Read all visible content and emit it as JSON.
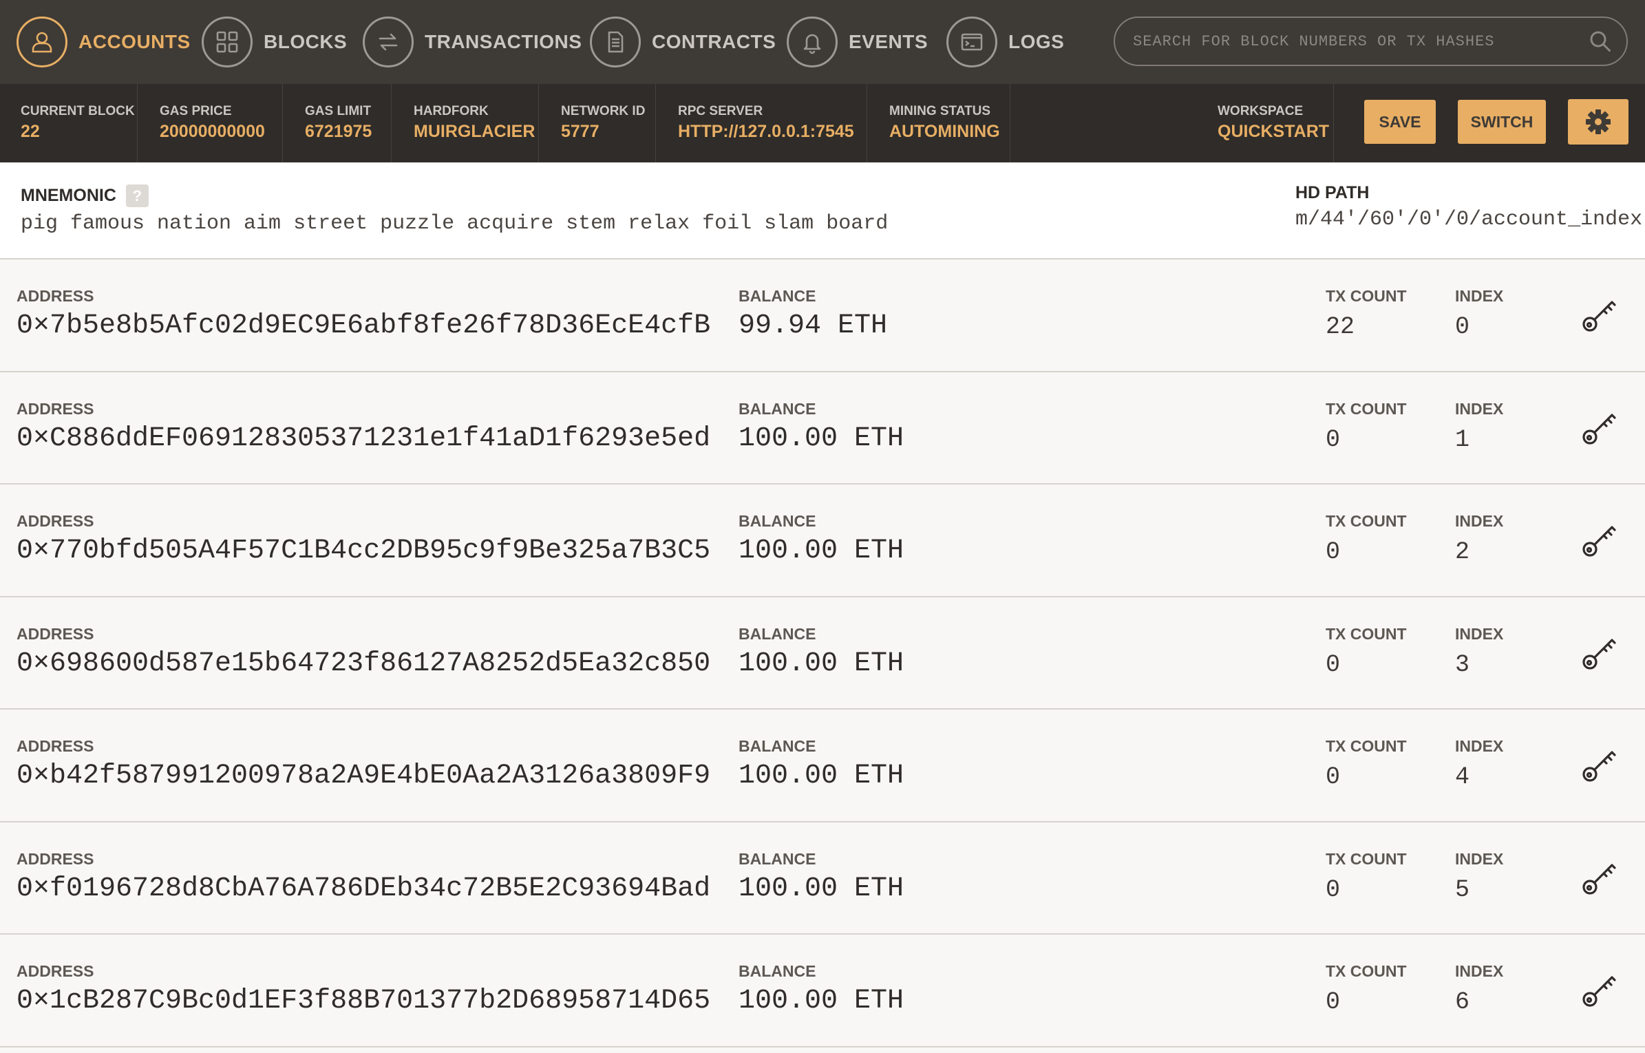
{
  "nav": {
    "items": [
      {
        "label": "ACCOUNTS",
        "icon": "user-icon",
        "active": true
      },
      {
        "label": "BLOCKS",
        "icon": "blocks-icon",
        "active": false
      },
      {
        "label": "TRANSACTIONS",
        "icon": "transactions-icon",
        "active": false
      },
      {
        "label": "CONTRACTS",
        "icon": "contracts-icon",
        "active": false
      },
      {
        "label": "EVENTS",
        "icon": "bell-icon",
        "active": false
      },
      {
        "label": "LOGS",
        "icon": "terminal-icon",
        "active": false
      }
    ],
    "search_placeholder": "SEARCH FOR BLOCK NUMBERS OR TX HASHES"
  },
  "status": {
    "current_block": {
      "label": "CURRENT BLOCK",
      "value": "22"
    },
    "gas_price": {
      "label": "GAS PRICE",
      "value": "20000000000"
    },
    "gas_limit": {
      "label": "GAS LIMIT",
      "value": "6721975"
    },
    "hardfork": {
      "label": "HARDFORK",
      "value": "MUIRGLACIER"
    },
    "network_id": {
      "label": "NETWORK ID",
      "value": "5777"
    },
    "rpc_server": {
      "label": "RPC SERVER",
      "value": "HTTP://127.0.0.1:7545"
    },
    "mining_status": {
      "label": "MINING STATUS",
      "value": "AUTOMINING"
    },
    "workspace": {
      "label": "WORKSPACE",
      "value": "QUICKSTART"
    },
    "save_label": "SAVE",
    "switch_label": "SWITCH"
  },
  "mnemonic": {
    "label": "MNEMONIC",
    "help": "?",
    "words": "pig famous nation aim street puzzle acquire stem relax foil slam board",
    "hd_path_label": "HD PATH",
    "hd_path": "m/44'/60'/0'/0/account_index"
  },
  "labels": {
    "address": "ADDRESS",
    "balance": "BALANCE",
    "tx_count": "TX COUNT",
    "index": "INDEX"
  },
  "accounts": [
    {
      "address": "0×7b5e8b5Afc02d9EC9E6abf8fe26f78D36EcE4cfB",
      "balance": "99.94 ETH",
      "tx_count": "22",
      "index": "0"
    },
    {
      "address": "0×C886ddEF069128305371231e1f41aD1f6293e5ed",
      "balance": "100.00 ETH",
      "tx_count": "0",
      "index": "1"
    },
    {
      "address": "0×770bfd505A4F57C1B4cc2DB95c9f9Be325a7B3C5",
      "balance": "100.00 ETH",
      "tx_count": "0",
      "index": "2"
    },
    {
      "address": "0×698600d587e15b64723f86127A8252d5Ea32c850",
      "balance": "100.00 ETH",
      "tx_count": "0",
      "index": "3"
    },
    {
      "address": "0×b42f587991200978a2A9E4bE0Aa2A3126a3809F9",
      "balance": "100.00 ETH",
      "tx_count": "0",
      "index": "4"
    },
    {
      "address": "0×f0196728d8CbA76A786DEb34c72B5E2C93694Bad",
      "balance": "100.00 ETH",
      "tx_count": "0",
      "index": "5"
    },
    {
      "address": "0×1cB287C9Bc0d1EF3f88B701377b2D68958714D65",
      "balance": "100.00 ETH",
      "tx_count": "0",
      "index": "6"
    }
  ],
  "colors": {
    "accent": "#e7ae64",
    "nav_bg": "#3e3a36",
    "status_bg": "#2f2c29"
  }
}
